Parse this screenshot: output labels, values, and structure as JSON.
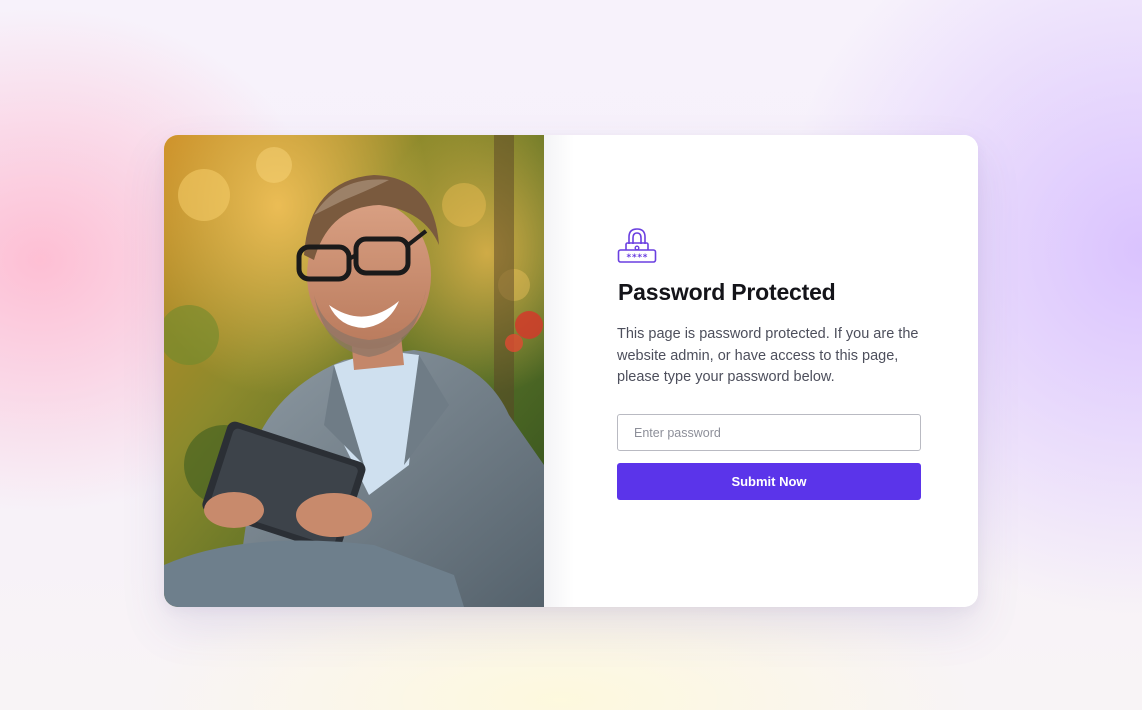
{
  "card": {
    "photo_alt": "Smiling man in grey blazer using a tablet outdoors",
    "icon": "password-lock-icon",
    "title": "Password Protected",
    "description": "This page is password protected. If you are the website admin, or have access to this page, please type your password below.",
    "password_placeholder": "Enter password",
    "password_value": "",
    "submit_label": "Submit Now"
  },
  "colors": {
    "accent": "#5b34ea",
    "icon": "#6a3fe0",
    "title": "#141419",
    "body_text": "#4d4f5c"
  }
}
